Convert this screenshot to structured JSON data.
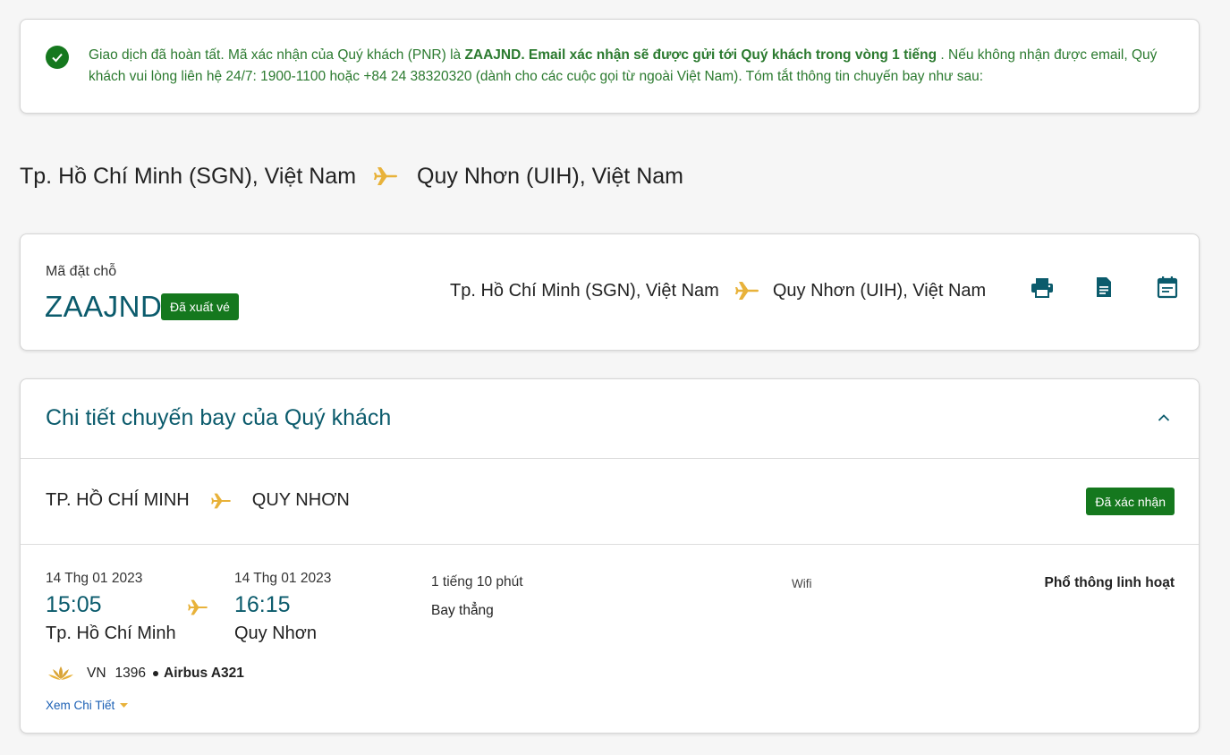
{
  "banner": {
    "text_1": "Giao dịch đã hoàn tất. Mã xác nhận của Quý khách (PNR) là ",
    "pnr_bold": "ZAAJND.",
    "email_notice_bold": " Email xác nhận sẽ được gửi tới Quý khách trong vòng 1 tiếng",
    "text_2": " . Nếu không nhận được email, Quý khách vui lòng liên hệ 24/7: 1900-1100 hoặc +84 24 38320320 (dành cho các cuộc gọi từ ngoài Việt Nam). Tóm tắt thông tin chuyến bay như sau:"
  },
  "route_heading": {
    "origin": "Tp. Hồ Chí Minh (SGN), Việt Nam",
    "destination": "Quy Nhơn (UIH), Việt Nam"
  },
  "booking": {
    "label": "Mã đặt chỗ",
    "code": "ZAAJND",
    "status": "Đã xuất vé",
    "origin": "Tp. Hồ Chí Minh (SGN), Việt Nam",
    "destination": "Quy Nhơn (UIH), Việt Nam",
    "actions": [
      "printer-icon",
      "document-icon",
      "calendar-icon"
    ]
  },
  "details": {
    "title": "Chi tiết chuyến bay của Quý khách",
    "segment": {
      "origin": "TP. HỒ CHÍ MINH",
      "destination": "QUY NHƠN",
      "status": "Đã xác nhận"
    },
    "departure": {
      "date": "14 Thg 01 2023",
      "time": "15:05",
      "city": "Tp. Hồ Chí Minh"
    },
    "arrival": {
      "date": "14 Thg 01 2023",
      "time": "16:15",
      "city": "Quy Nhơn"
    },
    "duration": "1 tiếng 10 phút",
    "stops": "Bay thẳng",
    "amenity": "Wifi",
    "fare_class": "Phổ thông linh hoạt",
    "carrier": "VN",
    "flight_number": "1396",
    "aircraft": "Airbus A321",
    "more_link": "Xem Chi Tiết"
  },
  "colors": {
    "accent_teal": "#0b5b6c",
    "success_green": "#15781e",
    "banner_text": "#2b7a2f",
    "plane_gold": "#e8b23a",
    "link_blue": "#1a5fb4"
  }
}
